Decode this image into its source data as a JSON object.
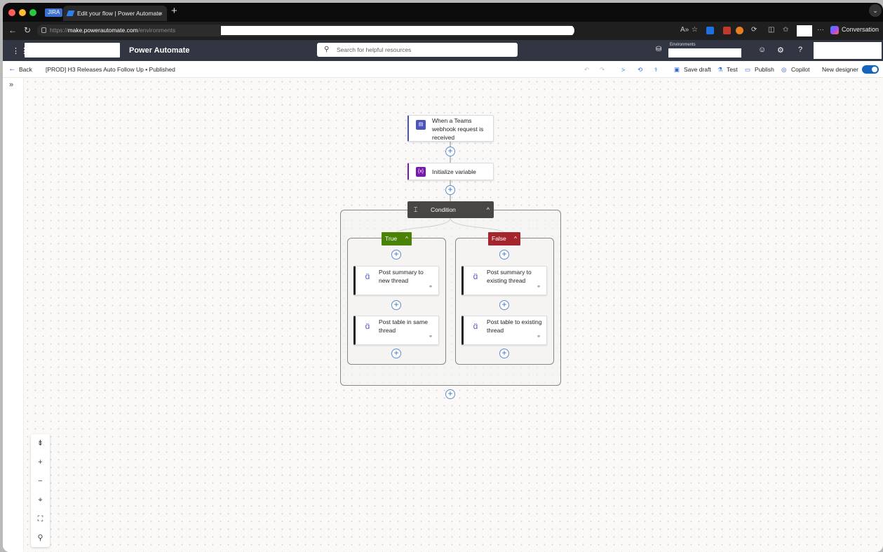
{
  "browser": {
    "tabs": [
      {
        "label": "JIRA"
      },
      {
        "label": "Edit your flow | Power Automate"
      }
    ],
    "new_tab": "+",
    "close_tab": "×",
    "url_protocol": "https://",
    "url_host": "make.powerautomate.com",
    "url_path": "/environments",
    "conversation_label": "Conversation",
    "overflow": "···"
  },
  "app": {
    "name": "Power Automate",
    "search_placeholder": "Search for helpful resources",
    "environments_label": "Environments",
    "help": "?"
  },
  "commandbar": {
    "back": "Back",
    "flow_title": "[PROD] H3 Releases Auto Follow Up • Published",
    "save_draft": "Save draft",
    "test": "Test",
    "publish": "Publish",
    "copilot": "Copilot",
    "new_designer": "New designer",
    "new_designer_on": true
  },
  "flow": {
    "trigger": {
      "label": "When a Teams webhook request is received",
      "icon": "teams-webhook-icon",
      "color": "#4b53bc"
    },
    "init_variable": {
      "label": "Initialize variable",
      "icon": "variable-icon",
      "color": "#7719aa"
    },
    "condition": {
      "label": "Condition"
    },
    "true_branch": {
      "label": "True",
      "color": "#498205",
      "actions": [
        {
          "label": "Post summary to new thread"
        },
        {
          "label": "Post table in same thread"
        }
      ]
    },
    "false_branch": {
      "label": "False",
      "color": "#a4262c",
      "actions": [
        {
          "label": "Post summary to existing thread"
        },
        {
          "label": "Post table to existing thread"
        }
      ]
    }
  },
  "canvas_controls": [
    "fit-icon",
    "zoom-in-icon",
    "zoom-out-icon",
    "center-icon",
    "minimap-icon",
    "search-icon"
  ]
}
